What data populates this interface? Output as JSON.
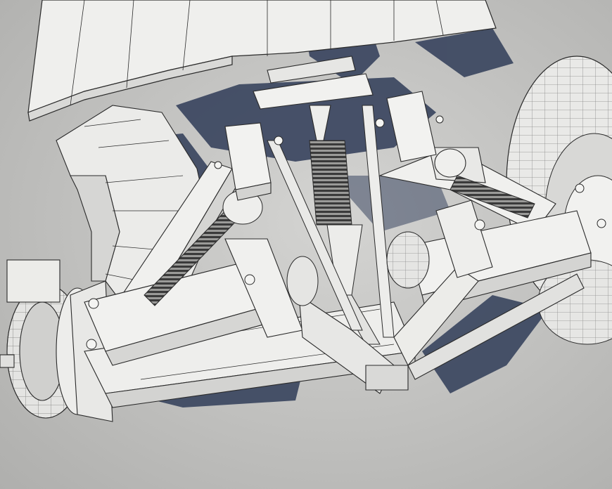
{
  "scene": {
    "subject": "suspension-wireframe-render",
    "colors": {
      "background": "#bdbdbb",
      "floor_light": "#d2d2d0",
      "shadow": "#3b4660",
      "part_fill": "#eeeeec",
      "part_shade": "#d8d8d6",
      "wire": "#2a2a2a"
    }
  }
}
